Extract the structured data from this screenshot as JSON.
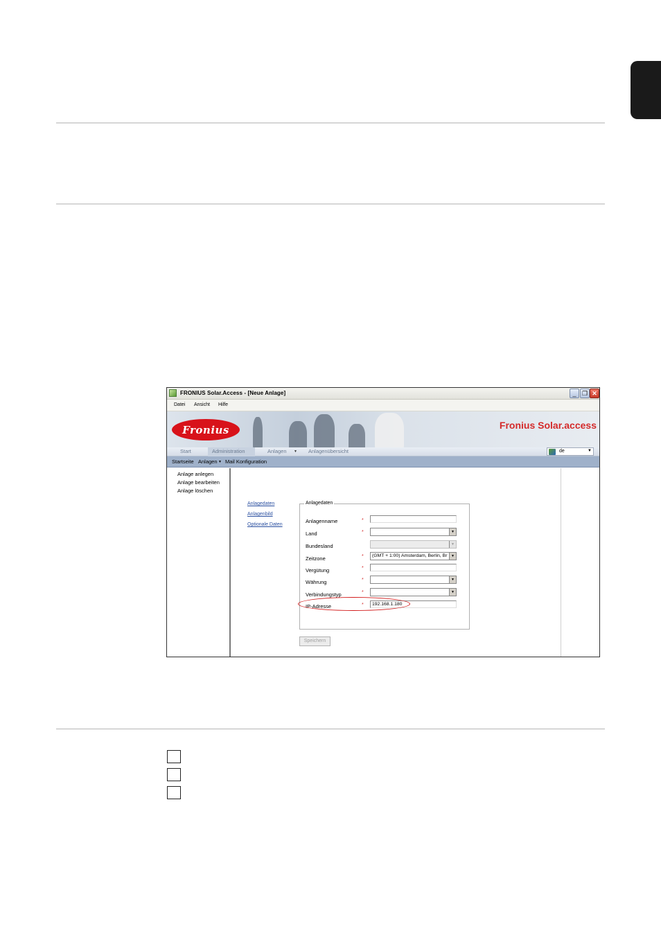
{
  "window": {
    "title": "FRONIUS Solar.Access - [Neue Anlage]",
    "controls": [
      "_",
      "❐",
      "✕"
    ]
  },
  "menu": [
    "Datei",
    "Ansicht",
    "Hilfe"
  ],
  "banner": {
    "logo_text": "Fronius",
    "title": "Fronius Solar.access"
  },
  "nav": {
    "items": [
      "Start",
      "Administration",
      "Anlagen",
      "Anlagenübersicht"
    ],
    "dropdown_marker": "▼",
    "language": "de",
    "language_arrow": "▼"
  },
  "subnav": [
    "Startseite",
    "Anlagen",
    "▼",
    "Mail Konfiguration"
  ],
  "sidebar": [
    "Anlage anlegen",
    "Anlage bearbeiten",
    "Anlage löschen"
  ],
  "links": [
    "Anlagedaten",
    "Anlagenbild",
    "Optionale Daten"
  ],
  "form": {
    "legend": "Anlagedaten",
    "required_mark": "*",
    "fields": {
      "anlagenname": {
        "label": "Anlagenname",
        "value": ""
      },
      "land": {
        "label": "Land",
        "value": ""
      },
      "bundesland": {
        "label": "Bundesland",
        "value": ""
      },
      "zeitzone": {
        "label": "Zeitzone",
        "value": "(GMT + 1:00) Amsterdam, Berlin, Br"
      },
      "verguetung": {
        "label": "Vergütung",
        "value": ""
      },
      "waehrung": {
        "label": "Währung",
        "value": ""
      },
      "verbindungstyp": {
        "label": "Verbindungstyp",
        "value": ""
      },
      "ip_adresse": {
        "label": "IP-Adresse",
        "value": "192.168.1.180"
      }
    },
    "select_arrow": "▼",
    "save_label": "Speichern"
  },
  "colors": {
    "accent_red": "#d42a2a",
    "subbar_blue": "#9fb1ca",
    "link_blue": "#2a4fa0"
  }
}
